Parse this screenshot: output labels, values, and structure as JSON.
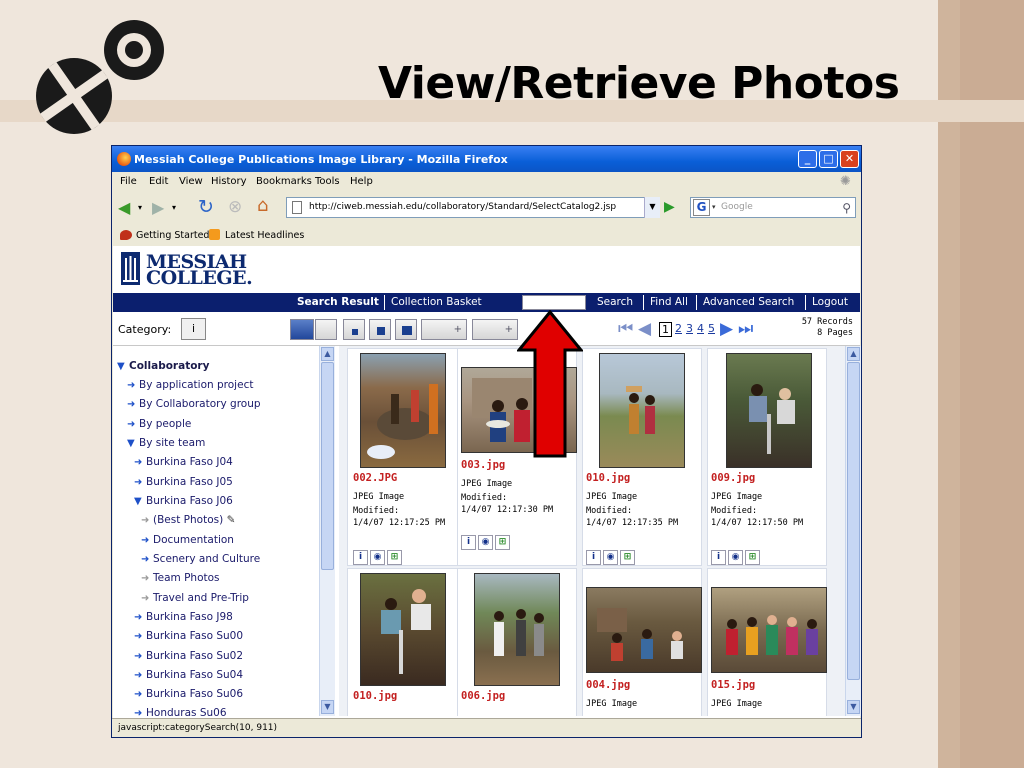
{
  "slide": {
    "title": "View/Retrieve Photos"
  },
  "browser": {
    "window_title": "Messiah College Publications Image Library - Mozilla Firefox",
    "menu": [
      "File",
      "Edit",
      "View",
      "History",
      "Bookmarks",
      "Tools",
      "Help"
    ],
    "url": "http://ciweb.messiah.edu/collaboratory/Standard/SelectCatalog2.jsp",
    "search_placeholder": "Google",
    "bookmarks": [
      "Getting Started",
      "Latest Headlines"
    ],
    "status_text": "javascript:categorySearch(10, 911)"
  },
  "app": {
    "logo_line1": "MESSIAH",
    "logo_line2": "COLLEGE.",
    "nav": {
      "search_result": "Search Result",
      "collection_basket": "Collection Basket",
      "search": "Search",
      "find_all": "Find All",
      "advanced_search": "Advanced Search",
      "logout": "Logout"
    },
    "category_label": "Category:",
    "category_icon_text": "i",
    "pages": [
      "1",
      "2",
      "3",
      "4",
      "5"
    ],
    "current_page": "1",
    "records_line1": "57 Records",
    "records_line2": "8 Pages"
  },
  "tree": [
    {
      "label": "Collaboratory",
      "bold": true
    },
    {
      "label": "By application project"
    },
    {
      "label": "By Collaboratory group"
    },
    {
      "label": "By people"
    },
    {
      "label": "By site team"
    },
    {
      "label": "Burkina Faso J04"
    },
    {
      "label": "Burkina Faso J05"
    },
    {
      "label": "Burkina Faso J06"
    },
    {
      "label": "(Best Photos)"
    },
    {
      "label": "Documentation"
    },
    {
      "label": "Scenery and Culture"
    },
    {
      "label": "Team Photos"
    },
    {
      "label": "Travel and Pre-Trip"
    },
    {
      "label": "Burkina Faso J98"
    },
    {
      "label": "Burkina Faso Su00"
    },
    {
      "label": "Burkina Faso Su02"
    },
    {
      "label": "Burkina Faso Su04"
    },
    {
      "label": "Burkina Faso Su06"
    },
    {
      "label": "Honduras Su06"
    }
  ],
  "photos": [
    {
      "name": "002.JPG",
      "type": "JPEG Image",
      "modified_label": "Modified:",
      "modified": "1/4/07 12:17:25 PM"
    },
    {
      "name": "003.jpg",
      "type": "JPEG Image",
      "modified_label": "Modified:",
      "modified": "1/4/07 12:17:30 PM"
    },
    {
      "name": "010.jpg",
      "type": "JPEG Image",
      "modified_label": "Modified:",
      "modified": "1/4/07 12:17:35 PM"
    },
    {
      "name": "009.jpg",
      "type": "JPEG Image",
      "modified_label": "Modified:",
      "modified": "1/4/07 12:17:50 PM"
    },
    {
      "name": "010.jpg",
      "type": "",
      "modified_label": "",
      "modified": ""
    },
    {
      "name": "006.jpg",
      "type": "",
      "modified_label": "",
      "modified": ""
    },
    {
      "name": "004.jpg",
      "type": "JPEG Image",
      "modified_label": "",
      "modified": ""
    },
    {
      "name": "015.jpg",
      "type": "JPEG Image",
      "modified_label": "",
      "modified": ""
    }
  ],
  "colors": {
    "nav_bg": "#0b1f6e",
    "filename": "#c32020",
    "arrow": "#e00000"
  }
}
